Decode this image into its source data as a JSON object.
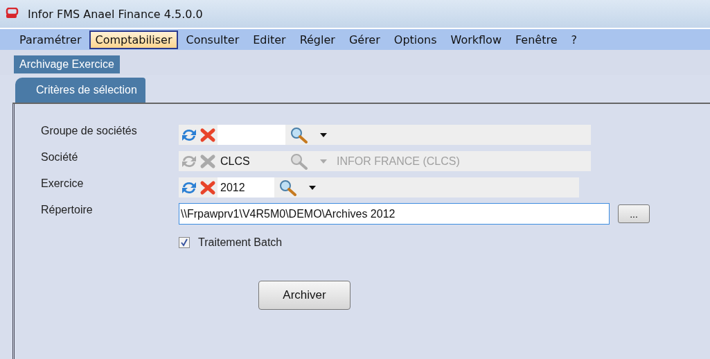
{
  "window": {
    "title": "Infor FMS Anael Finance 4.5.0.0"
  },
  "menu": [
    {
      "label": "Paramétrer",
      "selected": false
    },
    {
      "label": "Comptabiliser",
      "selected": true
    },
    {
      "label": "Consulter",
      "selected": false
    },
    {
      "label": "Editer",
      "selected": false
    },
    {
      "label": "Régler",
      "selected": false
    },
    {
      "label": "Gérer",
      "selected": false
    },
    {
      "label": "Options",
      "selected": false
    },
    {
      "label": "Workflow",
      "selected": false
    },
    {
      "label": "Fenêtre",
      "selected": false
    },
    {
      "label": "?",
      "selected": false
    }
  ],
  "document_tabs": [
    {
      "label": "Archivage Exercice",
      "selected": true
    }
  ],
  "form_tabs": [
    {
      "label": "Critères de sélection",
      "selected": true
    }
  ],
  "fields": [
    {
      "kind": "lookup",
      "label": "Groupe de sociétés",
      "disabled": false
    },
    {
      "kind": "lookup",
      "label": "Société",
      "value": "CLCS",
      "description": "INFOR FRANCE (CLCS)",
      "disabled": true
    },
    {
      "kind": "lookup",
      "label": "Exercice",
      "value": "2012",
      "disabled": false
    },
    {
      "kind": "path",
      "label": "Répertoire",
      "value": "\\\\Frpawprv1\\V4R5M0\\DEMO\\Archives 2012",
      "browse": "..."
    }
  ],
  "checkbox": {
    "label": "Traitement Batch",
    "checked": true
  },
  "buttons": [
    {
      "label": "Archiver"
    }
  ]
}
